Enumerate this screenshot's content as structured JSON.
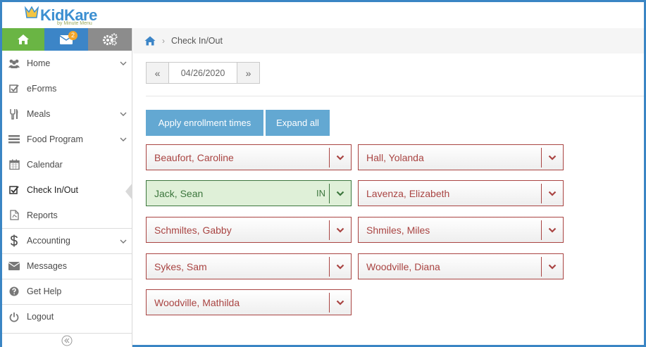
{
  "app": {
    "logo_text": "KidKare",
    "logo_sub": "by Minute Menu"
  },
  "tabs": {
    "mail_badge": "2"
  },
  "sidebar": {
    "items": [
      {
        "label": "Home",
        "icon": "people-icon",
        "chevron": true
      },
      {
        "label": "eForms",
        "icon": "checkbox-icon",
        "chevron": false
      },
      {
        "label": "Meals",
        "icon": "utensils-icon",
        "chevron": true
      },
      {
        "label": "Food Program",
        "icon": "list-icon",
        "chevron": true
      },
      {
        "label": "Calendar",
        "icon": "calendar-icon",
        "chevron": false
      },
      {
        "label": "Check In/Out",
        "icon": "checkbox-icon",
        "chevron": false,
        "active": true
      },
      {
        "label": "Reports",
        "icon": "pdf-icon",
        "chevron": false
      },
      {
        "label": "Accounting",
        "icon": "dollar-icon",
        "chevron": true
      },
      {
        "label": "Messages",
        "icon": "envelope-icon",
        "chevron": false
      },
      {
        "label": "Get Help",
        "icon": "help-icon",
        "chevron": false
      },
      {
        "label": "Logout",
        "icon": "power-icon",
        "chevron": false
      }
    ]
  },
  "breadcrumb": {
    "current": "Check In/Out"
  },
  "date_nav": {
    "prev": "«",
    "date": "04/26/2020",
    "next": "»"
  },
  "actions": {
    "apply_label": "Apply enrollment times",
    "expand_label": "Expand all"
  },
  "children": [
    {
      "name": "Beaufort, Caroline",
      "status": ""
    },
    {
      "name": "Hall, Yolanda",
      "status": ""
    },
    {
      "name": "Jack, Sean",
      "status": "IN"
    },
    {
      "name": "Lavenza, Elizabeth",
      "status": ""
    },
    {
      "name": "Schmiltes, Gabby",
      "status": ""
    },
    {
      "name": "Shmiles, Miles",
      "status": ""
    },
    {
      "name": "Sykes, Sam",
      "status": ""
    },
    {
      "name": "Woodville, Diana",
      "status": ""
    },
    {
      "name": "Woodville, Mathilda",
      "status": ""
    }
  ],
  "colors": {
    "home_tab": "#6ab544",
    "mail_tab": "#3c85c7",
    "settings_tab": "#8c8c8c",
    "action_button": "#63a8d2",
    "out_border": "#a94442",
    "in_fill": "#dff0d8"
  }
}
